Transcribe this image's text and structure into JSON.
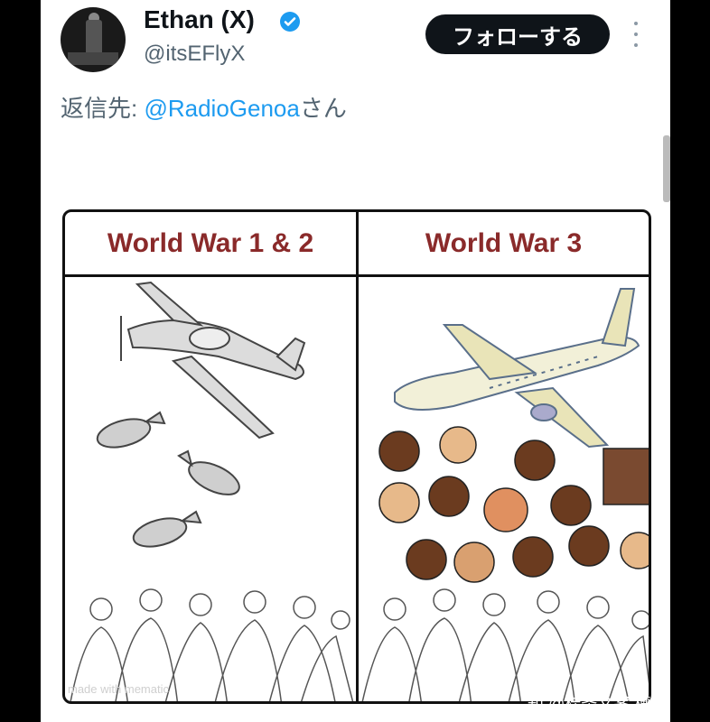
{
  "post": {
    "display_name": "Ethan (X)",
    "handle": "@itsEFlyX",
    "follow_label": "フォローする",
    "reply_prefix": "返信先: ",
    "reply_mention": "@RadioGenoa",
    "reply_suffix": "さん"
  },
  "meme": {
    "left_title": "World War 1 & 2",
    "right_title": "World War 3",
    "watermark": "made with mematic"
  },
  "overlay": {
    "watermark": "知 @桂圣⽂案 槽吧"
  },
  "colors": {
    "accent": "#1d9bf0",
    "follow_button": "#0f1419",
    "title_red": "#8a2a2a"
  }
}
